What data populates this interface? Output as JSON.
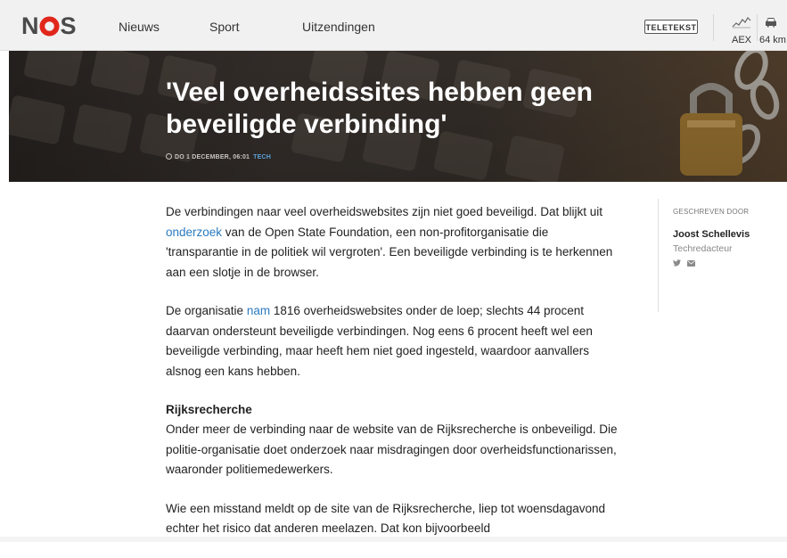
{
  "header": {
    "logo": {
      "left": "N",
      "right": "S"
    },
    "nav": [
      "Nieuws",
      "Sport",
      "Uitzendingen"
    ],
    "teletekst": "TELETEKST",
    "aex_label": "AEX",
    "traffic_label": "64 km",
    "icons": [
      "chart-icon",
      "car-icon"
    ]
  },
  "hero": {
    "title": "'Veel overheidssites hebben geen beveiligde verbinding'",
    "date": "DO 1 DECEMBER, 06:01",
    "category": "TECH"
  },
  "article": {
    "p1_before": "De verbindingen naar veel overheidswebsites zijn niet goed beveiligd. Dat blijkt uit ",
    "p1_link": "onderzoek",
    "p1_after": " van de Open State Foundation, een non-profitorganisatie die 'transparantie in de politiek wil vergroten'. Een beveiligde verbinding is te herkennen aan een slotje in de browser.",
    "p2_before": "De organisatie ",
    "p2_link": "nam",
    "p2_after": " 1816 overheidswebsites onder de loep; slechts 44 procent daarvan ondersteunt beveiligde verbindingen. Nog eens 6 procent heeft wel een beveiligde verbinding, maar heeft hem niet goed ingesteld, waardoor aanvallers alsnog een kans hebben.",
    "subheading": "Rijksrecherche",
    "p3": "Onder meer de verbinding naar de website van de Rijksrecherche is onbeveiligd. Die politie-organisatie doet onderzoek naar misdragingen door overheidsfunctionarissen, waaronder politiemedewerkers.",
    "p4": "Wie een misstand meldt op de site van de Rijksrecherche, liep tot woensdagavond echter het risico dat anderen meelazen. Dat kon bijvoorbeeld"
  },
  "author": {
    "label": "GESCHREVEN DOOR",
    "name": "Joost Schellevis",
    "role": "Techredacteur",
    "icons": [
      "twitter-icon",
      "mail-icon"
    ]
  },
  "colors": {
    "header_bg": "#f1f1f1",
    "link": "#2b7bc0",
    "logo_red": "#e1261c",
    "tag": "#5aa0d8"
  }
}
